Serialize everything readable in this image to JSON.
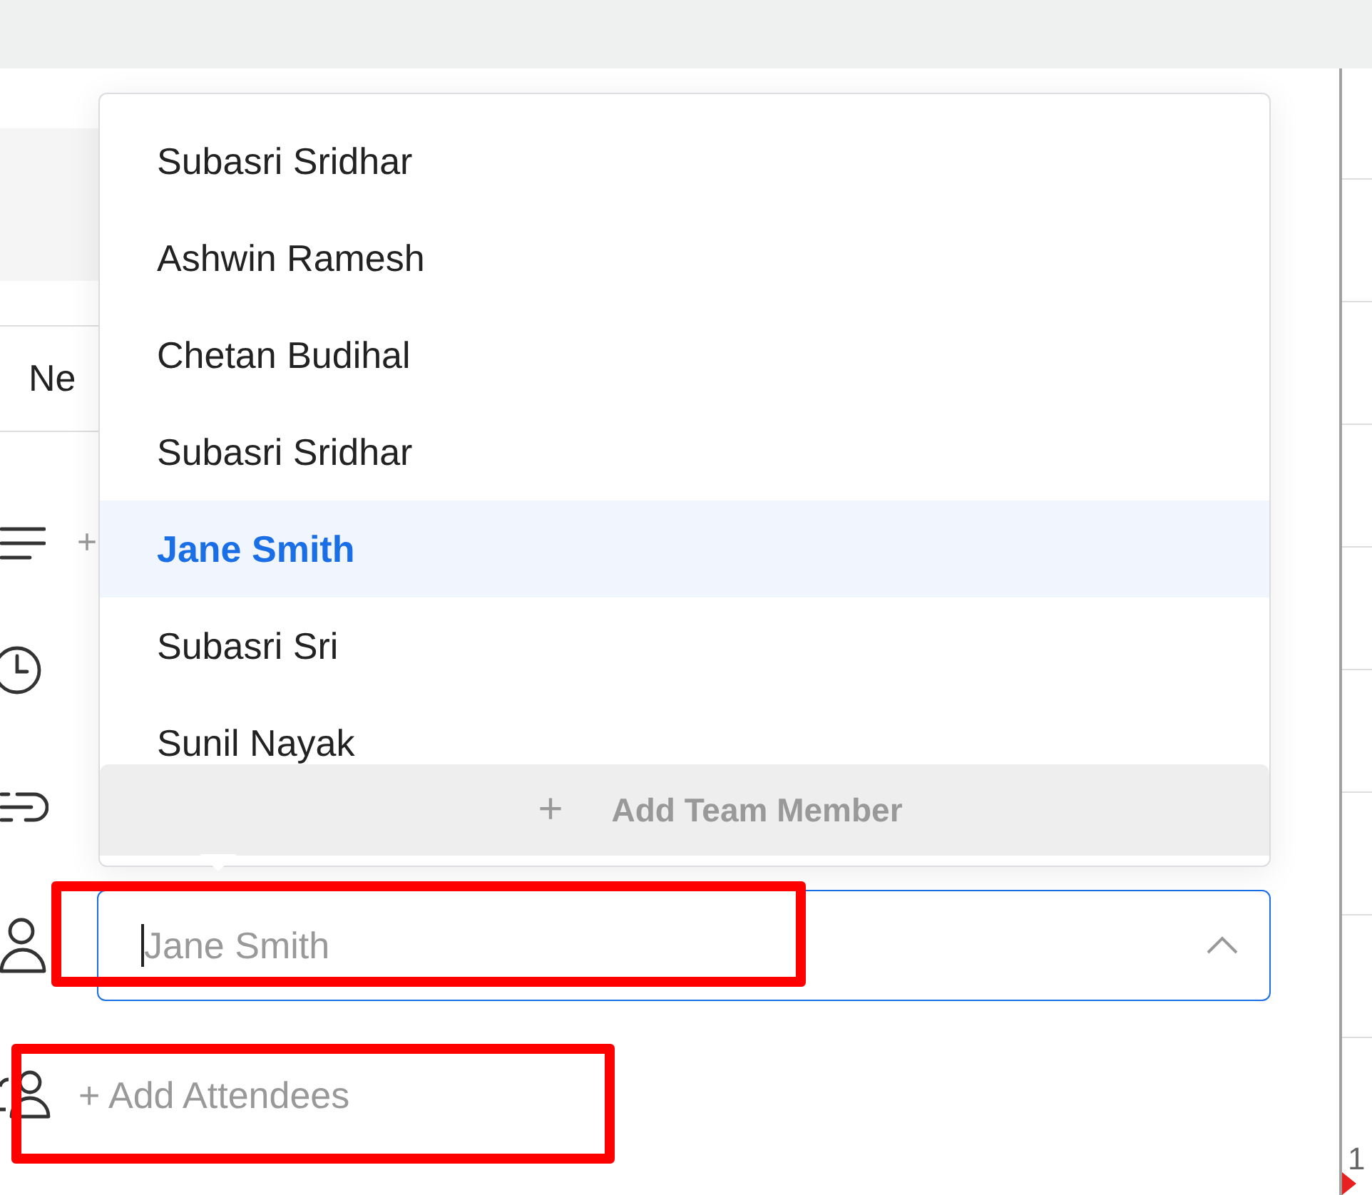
{
  "form": {
    "title_field": {
      "value": "Ne"
    },
    "description_prefix": "+",
    "assignee": {
      "placeholder": "Jane Smith",
      "expanded": true
    },
    "add_attendees": "+ Add Attendees"
  },
  "dropdown": {
    "options": [
      {
        "label": "Subasri Sridhar",
        "selected": false
      },
      {
        "label": "Ashwin Ramesh",
        "selected": false
      },
      {
        "label": "Chetan Budihal",
        "selected": false
      },
      {
        "label": "Subasri Sridhar",
        "selected": false
      },
      {
        "label": "Jane Smith",
        "selected": true
      },
      {
        "label": "Subasri Sri",
        "selected": false
      },
      {
        "label": "Sunil Nayak",
        "selected": false
      }
    ],
    "footer": {
      "icon": "+",
      "label": "Add Team Member"
    }
  },
  "calendar": {
    "hour_label": "1"
  },
  "annotations": [
    {
      "kind": "highlight"
    },
    {
      "kind": "highlight"
    }
  ]
}
